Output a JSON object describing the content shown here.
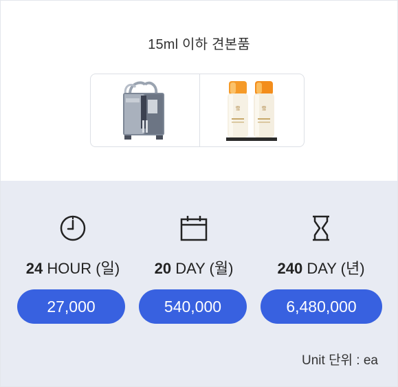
{
  "title": "15ml 이하 견본품",
  "images": [
    {
      "alt": "filling-machine"
    },
    {
      "alt": "sample-bottles"
    }
  ],
  "stats": [
    {
      "icon": "clock-icon",
      "num": "24",
      "unit": "HOUR (일)",
      "value": "27,000"
    },
    {
      "icon": "calendar-icon",
      "num": "20",
      "unit": "DAY (월)",
      "value": "540,000"
    },
    {
      "icon": "hourglass-icon",
      "num": "240",
      "unit": "DAY (년)",
      "value": "6,480,000"
    }
  ],
  "unit_note": "Unit 단위 : ea",
  "colors": {
    "accent": "#3861e0",
    "panel_bg": "#e8ebf3"
  }
}
